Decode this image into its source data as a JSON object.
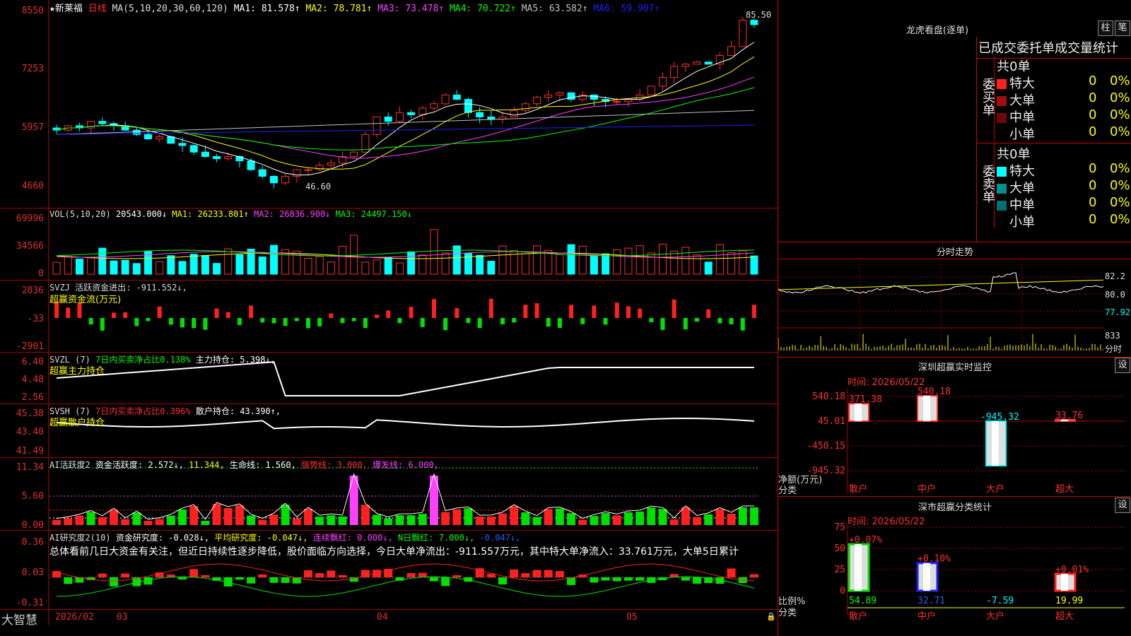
{
  "app_name": "大智慧",
  "stock": {
    "name": "★新莱福",
    "period": "日线"
  },
  "main_chart": {
    "ma_header": "MA(5,10,20,30,60,120)",
    "ma": [
      {
        "label": "MA1: 81.578↑",
        "color": "#ffffff"
      },
      {
        "label": "MA2: 78.781↑",
        "color": "#ffff00"
      },
      {
        "label": "MA3: 73.478↑",
        "color": "#ff40ff"
      },
      {
        "label": "MA4: 70.722↑",
        "color": "#00ff00"
      },
      {
        "label": "MA5: 63.582↑",
        "color": "#c0c0c0"
      },
      {
        "label": "MA6: 59.907↑",
        "color": "#2020ff"
      }
    ],
    "y_ticks": [
      "8550",
      "7253",
      "5957",
      "4660"
    ],
    "hi_label": "85.50",
    "lo_label": "46.60"
  },
  "vol": {
    "header": "VOL(5,10,20)",
    "value": "20543.000↓",
    "ma": [
      {
        "label": "MA1: 26233.801↑",
        "color": "#ffff00"
      },
      {
        "label": "MA2: 26836.900↓",
        "color": "#ff40ff"
      },
      {
        "label": "MA3: 24497.150↓",
        "color": "#00ff00"
      }
    ],
    "y_ticks": [
      "69996",
      "34566",
      "0"
    ]
  },
  "svzj": {
    "line1": "SVZJ  活跃资金进出: -911.552↓,",
    "line2": "超赢资金流(万元)",
    "y_ticks": [
      "2836",
      "-33",
      "-2901"
    ]
  },
  "svzl": {
    "l1": "SVZL (7)",
    "l2": "7日内买卖净占比0.138%",
    "l3": "主力持仓: 5.398↓,",
    "line2": "超赢主力持仓",
    "y_ticks": [
      "6.40",
      "4.48",
      "2.56"
    ]
  },
  "svsh": {
    "l1": "SVSH (7)",
    "l2": "7日内买卖净占比0.396%",
    "l3": "散户持仓: 43.390↑,",
    "line2": "超赢散户持仓",
    "y_ticks": [
      "45.38",
      "43.40",
      "41.49"
    ]
  },
  "ai_act": {
    "l1": "AI活跃度2",
    "l2": "资金活跃度: 2.572↓,",
    "l3": "11.344,",
    "l4": "生命线: 1.560,",
    "l5": "强势线: 3.000,",
    "l6": "爆发线: 6.000,",
    "y_ticks": [
      "11.34",
      "5.60",
      "0.00"
    ]
  },
  "ai_res": {
    "l1": "AI研究度2(10)",
    "l2": "资金研究度: -0.028↓,",
    "l3": "平均研究度: -0.047↓,",
    "l4": "连续飘红: 0.000↓,",
    "l5": "N日飘红: 7.000↓,",
    "l6": "-0.047↓,",
    "comment": "总体看前几日大资金有关注，但近日持续性逐步降低，股价面临方向选择，今日大单净流出：-911.557万元，其中特大单净流入：33.761万元，大单5日累计",
    "y_ticks": [
      "0.36",
      "0.03",
      "-0.31"
    ]
  },
  "date_axis": [
    "2026/02",
    "03",
    "04",
    "05"
  ],
  "dragon": {
    "title": "龙虎看盘(逐单)",
    "btn_zhu": "柱",
    "btn_bi": "笔",
    "table_title": "已成交委托单成交量统计",
    "buy_side": "委买单",
    "sell_side": "委卖单",
    "buy_total": "共0单",
    "sell_total": "共0单",
    "rows_buy": [
      {
        "name": "特大",
        "val": "0",
        "pct": "0%",
        "color": "#ff2020"
      },
      {
        "name": "大单",
        "val": "0",
        "pct": "0%",
        "color": "#a01010"
      },
      {
        "name": "中单",
        "val": "0",
        "pct": "0%",
        "color": "#700808"
      },
      {
        "name": "小单",
        "val": "0",
        "pct": "0%",
        "color": ""
      }
    ],
    "rows_sell": [
      {
        "name": "特大",
        "val": "0",
        "pct": "0%",
        "color": "#00ffff"
      },
      {
        "name": "大单",
        "val": "0",
        "pct": "0%",
        "color": "#009090"
      },
      {
        "name": "中单",
        "val": "0",
        "pct": "0%",
        "color": "#007070"
      },
      {
        "name": "小单",
        "val": "0",
        "pct": "0%",
        "color": ""
      }
    ]
  },
  "intraday": {
    "title": "分时走势",
    "y_ticks": [
      "82.2",
      "80.0",
      "77.92"
    ],
    "vol_tick": "833",
    "vol_label": "分时"
  },
  "monitor": {
    "title": "深圳超赢实时监控",
    "btn": "设",
    "time": "时间: 2026/05/22",
    "y_ticks": [
      "540.18",
      "45.01",
      "-450.15",
      "-945.32"
    ],
    "unit": "净额(万元)",
    "cat_label": "分类",
    "bars": [
      {
        "cat": "散户",
        "value": "371.38"
      },
      {
        "cat": "中户",
        "value": "540.18"
      },
      {
        "cat": "大户",
        "value": "-945.32"
      },
      {
        "cat": "超大",
        "value": "33.76"
      }
    ]
  },
  "classify": {
    "title": "深市超赢分类统计",
    "btn": "设",
    "time": "时间: 2026/05/22",
    "y_ticks": [
      "75",
      "50",
      "25",
      "0"
    ],
    "unit": "比例%",
    "cat_label": "分类",
    "bars": [
      {
        "cat": "散户",
        "top": "+0.07%",
        "bottom": "54.89"
      },
      {
        "cat": "中户",
        "top": "+0.10%",
        "bottom": "32.71"
      },
      {
        "cat": "大户",
        "top": "",
        "bottom": "-7.59"
      },
      {
        "cat": "超大",
        "top": "+0.01%",
        "bottom": "19.99"
      }
    ]
  }
}
